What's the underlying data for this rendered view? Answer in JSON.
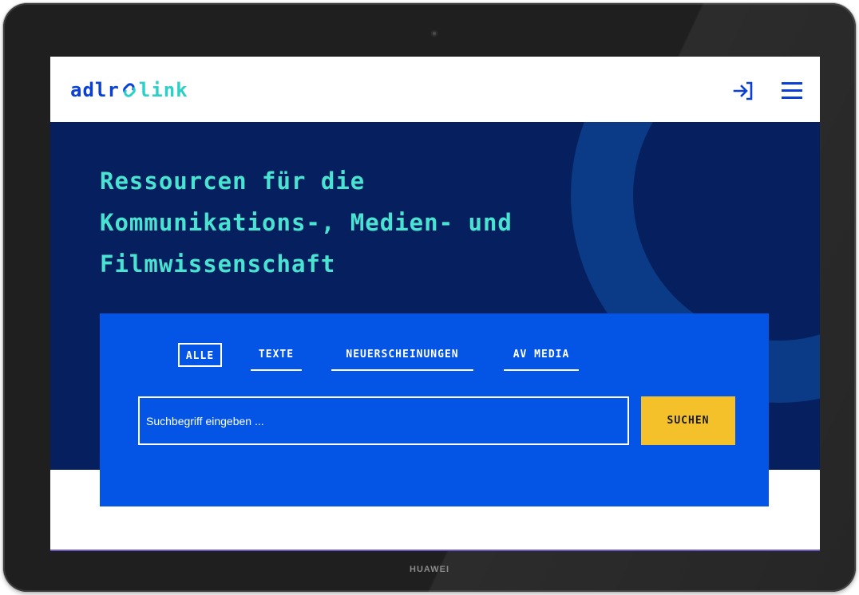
{
  "device": {
    "brand": "HUAWEI"
  },
  "header": {
    "logo_part1": "adlr",
    "logo_symbol": "∁",
    "logo_part2": "link",
    "login_icon": "login-arrow-icon",
    "menu_icon": "hamburger-menu-icon"
  },
  "hero": {
    "heading_line1": "Ressourcen für die",
    "heading_line2": "Kommunikations-, Medien- und",
    "heading_line3": "Filmwissenschaft"
  },
  "search": {
    "tabs": [
      {
        "label": "ALLE",
        "active": true
      },
      {
        "label": "TEXTE",
        "active": false
      },
      {
        "label": "NEUERSCHEINUNGEN",
        "active": false
      },
      {
        "label": "AV MEDIA",
        "active": false
      }
    ],
    "placeholder": "Suchbegriff eingeben ...",
    "value": "",
    "button_label": "SUCHEN"
  },
  "colors": {
    "brand_blue": "#0a3fd8",
    "brand_teal": "#2bd0c8",
    "hero_bg": "#06205f",
    "panel_blue": "#0455e6",
    "accent_yellow": "#f4c12a",
    "heading_teal": "#49e3d2"
  }
}
